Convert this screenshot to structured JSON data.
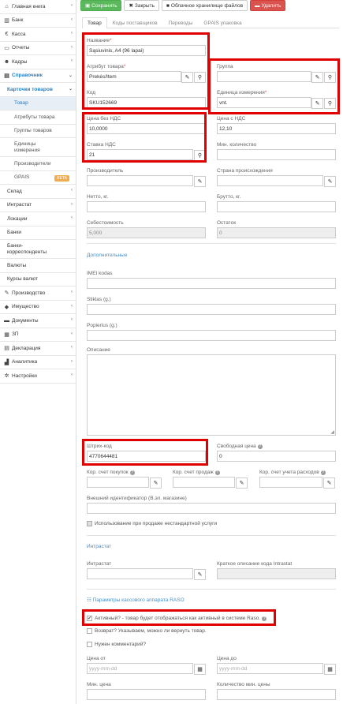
{
  "sidebar": {
    "items": [
      {
        "label": "Главная книга",
        "icon": "home-icon",
        "chev": true
      },
      {
        "label": "Банк",
        "icon": "bank-icon",
        "chev": true
      },
      {
        "label": "Касса",
        "icon": "euro-icon",
        "chev": true
      },
      {
        "label": "Отчеты",
        "icon": "report-icon",
        "chev": true
      },
      {
        "label": "Кадры",
        "icon": "users-icon",
        "chev": true
      },
      {
        "label": "Справочник",
        "icon": "book-icon",
        "chev": true,
        "active": true
      },
      {
        "label": "Карточки товаров",
        "sub": 1,
        "chev": true,
        "active": true
      },
      {
        "label": "Товар",
        "sub": 2,
        "active": true
      },
      {
        "label": "Атрибуты товара",
        "sub": 2
      },
      {
        "label": "Группы товаров",
        "sub": 2
      },
      {
        "label": "Единицы измерения",
        "sub": 2,
        "tall": true
      },
      {
        "label": "Производители",
        "sub": 2
      },
      {
        "label": "GPAIS",
        "sub": 2,
        "beta": "BETA"
      },
      {
        "label": "Склад",
        "sub": 1,
        "chev": true
      },
      {
        "label": "Интрастат",
        "sub": 1,
        "chev": true
      },
      {
        "label": "Локации",
        "sub": 1,
        "chev": true
      },
      {
        "label": "Банки",
        "sub": 1
      },
      {
        "label": "Банки-корреспонденты",
        "sub": 1,
        "tall": true
      },
      {
        "label": "Валюты",
        "sub": 1
      },
      {
        "label": "Курсы валют",
        "sub": 1
      },
      {
        "label": "Производство",
        "icon": "wrench-icon",
        "chev": true
      },
      {
        "label": "Имущество",
        "icon": "cube-icon",
        "chev": true
      },
      {
        "label": "Документы",
        "icon": "folder-icon",
        "chev": true
      },
      {
        "label": "ЗП",
        "icon": "calc-icon",
        "chev": true
      },
      {
        "label": "Декларация",
        "icon": "declaration-icon",
        "chev": true
      },
      {
        "label": "Аналитика",
        "icon": "chart-icon",
        "chev": true
      },
      {
        "label": "Настройки",
        "icon": "cogs-icon",
        "chev": true
      }
    ]
  },
  "toolbar": {
    "save": "Сохранить",
    "close": "Закрыть",
    "cloud": "Облачное хранилище файлов",
    "delete": "Удалить"
  },
  "tabs": [
    "Товар",
    "Коды поставщиков",
    "Переводы",
    "GPAIS упаковка"
  ],
  "form": {
    "name_label": "Название",
    "name_value": "Sąsiuvinis, A4 (96 lapai)",
    "attr_label": "Атрибут товара",
    "attr_value": "Prekės/Item",
    "group_label": "Группа",
    "group_value": "",
    "code_label": "Код",
    "code_value": "SKU152669",
    "unit_label": "Единица измерения",
    "unit_value": "vnt.",
    "price_novat_label": "Цена без НДС",
    "price_novat_value": "10,0000",
    "price_vat_label": "Цена с НДС",
    "price_vat_value": "12,10",
    "vat_label": "Ставка НДС",
    "vat_value": "21",
    "min_qty_label": "Мин. количество",
    "min_qty_value": "",
    "manufacturer_label": "Производитель",
    "country_label": "Страна происхождения",
    "netto_label": "Нетто, кг.",
    "brutto_label": "Брутто, кг.",
    "cost_label": "Себестоимость",
    "cost_value": "5,000",
    "stock_label": "Остаток",
    "stock_value": "0",
    "additional": "Дополнительные",
    "imei_label": "IMEI kodas",
    "stiklas_label": "Stiklas (g.)",
    "popierius_label": "Popierius (g.)",
    "desc_label": "Описание",
    "barcode_label": "Штрих-код",
    "barcode_value": "4770644481",
    "free_price_label": "Свободная цена",
    "free_price_value": "0",
    "kor_buy_label": "Кор. счет покупок",
    "kor_sell_label": "Кор. счет продаж",
    "kor_exp_label": "Кор. счет учета расходов",
    "ext_id_label": "Внешний идентификатор (В.эл. магазине)",
    "nonstd_label": "Использование при продаже нестандартной услуги",
    "intrastat_title": "Интрастат",
    "intrastat_label": "Интрастат",
    "intrastat_desc_label": "Краткое описание кода Intrastat",
    "raso_title": "Параметры кассового аппарата RASO",
    "active_label": "Активный? - товар будет отображаться как активный в системе Raso.",
    "return_label": "Возврат? Указываем, можно ли вернуть товар.",
    "comment_label": "Нужен комментарий?",
    "price_from_label": "Цена от",
    "price_to_label": "Цена до",
    "date_placeholder": "yyyy-mm-dd",
    "min_price_label": "Мин. цена",
    "min_price_qty_label": "Количество мин. цены"
  }
}
